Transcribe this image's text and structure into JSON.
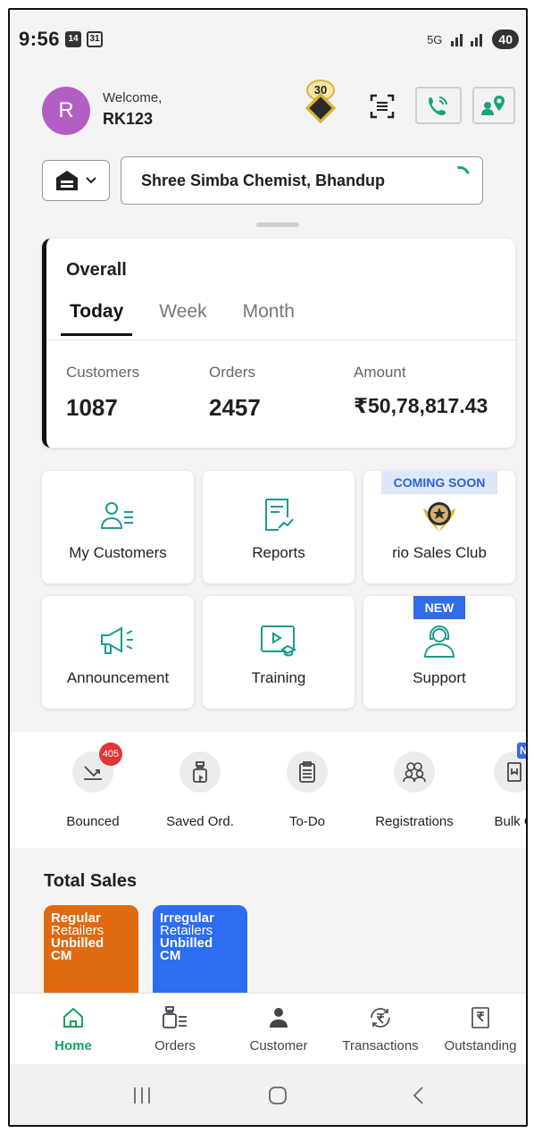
{
  "status_bar": {
    "time": "9:56",
    "icon_day": "14",
    "icon_cal": "31",
    "network": "5G",
    "battery": "40"
  },
  "header": {
    "avatar_letter": "R",
    "welcome": "Welcome,",
    "username": "RK123",
    "reward_count": "30"
  },
  "store": {
    "name": "Shree Simba Chemist, Bhandup"
  },
  "overall": {
    "title": "Overall",
    "tabs": [
      "Today",
      "Week",
      "Month"
    ],
    "active_tab": "Today",
    "stats": {
      "customers_label": "Customers",
      "customers_value": "1087",
      "orders_label": "Orders",
      "orders_value": "2457",
      "amount_label": "Amount",
      "amount_value": "₹50,78,817.43"
    }
  },
  "tiles": {
    "my_customers": "My Customers",
    "reports": "Reports",
    "sales_club": "rio Sales Club",
    "sales_club_tag": "COMING SOON",
    "announcement": "Announcement",
    "training": "Training",
    "support": "Support",
    "support_tag": "NEW"
  },
  "quick": {
    "bounced": "Bounced",
    "bounced_count": "405",
    "saved": "Saved Ord.",
    "todo": "To-Do",
    "registrations": "Registrations",
    "bulk": "Bulk O",
    "bulk_tag": "NEW"
  },
  "total_sales": {
    "title": "Total Sales",
    "card1": {
      "l1": "Regular",
      "l2": "Retailers",
      "l3": "Unbilled",
      "l4": "CM"
    },
    "card2": {
      "l1": "Irregular",
      "l2": "Retailers",
      "l3": "Unbilled",
      "l4": "CM"
    }
  },
  "bottom_nav": {
    "home": "Home",
    "orders": "Orders",
    "customer": "Customer",
    "transactions": "Transactions",
    "outstanding": "Outstanding"
  },
  "colors": {
    "accent_green": "#19a35d",
    "avatar": "#b25fc5",
    "orange": "#e06a12",
    "blue": "#2e6cf0"
  }
}
